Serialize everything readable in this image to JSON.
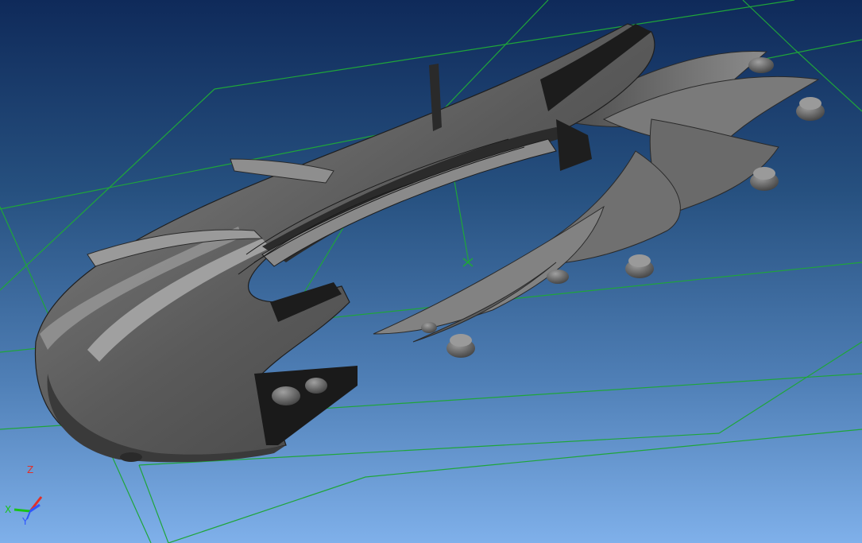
{
  "viewport": {
    "background_top": "#0f2a5a",
    "background_bottom": "#7fb0ea",
    "grid_color": "#1fa53a",
    "part_color": "#6e6e6e"
  },
  "triad": {
    "z_label": "Z",
    "x_label": "X",
    "y_label": "Y",
    "z_color": "#e0302a",
    "x_color": "#19c219",
    "y_color": "#2f56ff"
  }
}
